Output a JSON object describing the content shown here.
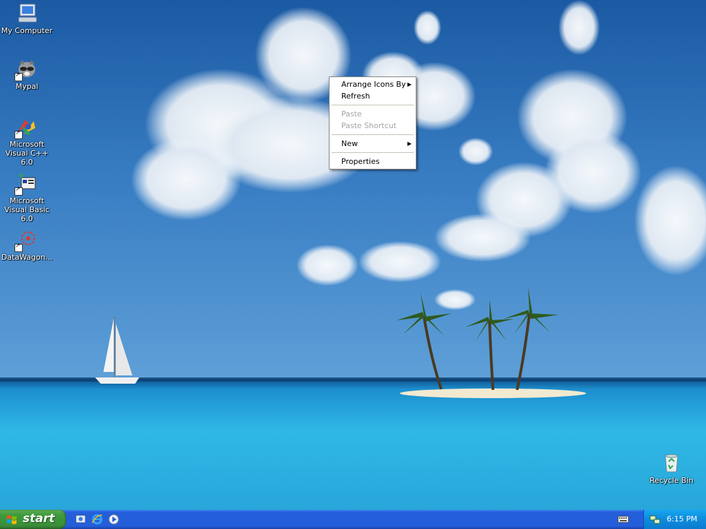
{
  "desktop": {
    "icons": [
      {
        "label": "My Computer"
      },
      {
        "label": "Mypal"
      },
      {
        "label": "Microsoft Visual C++ 6.0"
      },
      {
        "label": "Microsoft Visual Basic 6.0"
      },
      {
        "label": "DataWagon..."
      },
      {
        "label": "Recycle Bin"
      }
    ]
  },
  "context_menu": {
    "items": [
      {
        "label": "Arrange Icons By",
        "submenu": true,
        "enabled": true
      },
      {
        "label": "Refresh",
        "enabled": true
      },
      {
        "label": "Paste",
        "enabled": false
      },
      {
        "label": "Paste Shortcut",
        "enabled": false
      },
      {
        "label": "New",
        "submenu": true,
        "enabled": true
      },
      {
        "label": "Properties",
        "enabled": true
      }
    ],
    "submenu_arrow": "▶"
  },
  "taskbar": {
    "start_label": "start",
    "quick_launch": [
      {
        "icon": "show-desktop-icon"
      },
      {
        "icon": "internet-explorer-icon"
      },
      {
        "icon": "media-player-icon"
      }
    ],
    "tray": {
      "clock": "6:15 PM",
      "icons": [
        "keyboard-icon",
        "network-icon"
      ]
    }
  },
  "colors": {
    "taskbar_blue": "#245edb",
    "start_green": "#3c9a3a",
    "tray_blue": "#0f8fe0",
    "sky_top": "#1f5fa6",
    "sea": "#29b3e0"
  }
}
